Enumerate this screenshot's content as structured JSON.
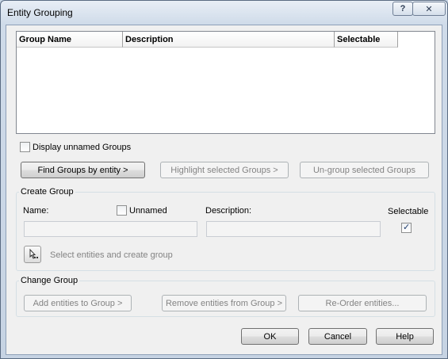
{
  "window": {
    "title": "Entity Grouping",
    "help_glyph": "?",
    "close_glyph": "✕"
  },
  "groups_list": {
    "columns": [
      "Group Name",
      "Description",
      "Selectable"
    ],
    "rows": []
  },
  "display_unnamed": {
    "label": "Display unnamed Groups",
    "checked": false
  },
  "actions": {
    "find": "Find Groups by entity >",
    "highlight": "Highlight selected Groups >",
    "ungroup": "Un-group selected Groups"
  },
  "create_group": {
    "title": "Create Group",
    "name_label": "Name:",
    "unnamed_label": "Unnamed",
    "unnamed_checked": false,
    "description_label": "Description:",
    "selectable_label": "Selectable",
    "selectable_checked": true,
    "name_value": "",
    "description_value": "",
    "select_entities_label": "Select entities and create group"
  },
  "change_group": {
    "title": "Change Group",
    "add": "Add entities to Group >",
    "remove": "Remove entities from Group >",
    "reorder": "Re-Order entities..."
  },
  "footer": {
    "ok": "OK",
    "cancel": "Cancel",
    "help": "Help"
  }
}
